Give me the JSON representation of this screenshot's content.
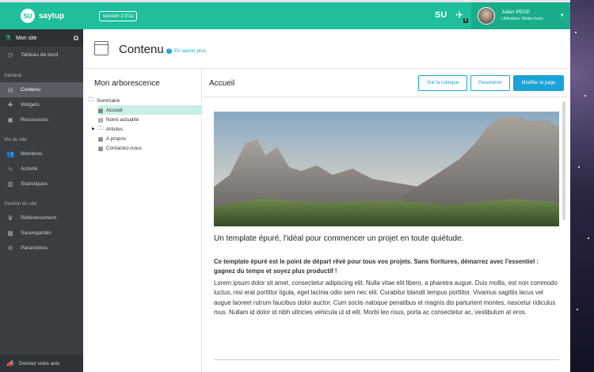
{
  "app": {
    "logo_mark": "SU",
    "logo_text": "saytup",
    "version": "version 2.01a"
  },
  "sidebar": {
    "site": {
      "label": "Mon site",
      "icon": "flask-icon"
    },
    "dashboard": "Tableau de bord",
    "sections": [
      {
        "title": "Général",
        "items": [
          {
            "label": "Contenu",
            "icon": "content-icon",
            "active": true
          },
          {
            "label": "Widgets",
            "icon": "puzzle-icon"
          },
          {
            "label": "Ressources",
            "icon": "image-icon"
          }
        ]
      },
      {
        "title": "Vie du site",
        "items": [
          {
            "label": "Membres",
            "icon": "users-icon"
          },
          {
            "label": "Activité",
            "icon": "activity-icon"
          },
          {
            "label": "Statistiques",
            "icon": "chart-icon"
          }
        ]
      },
      {
        "title": "Gestion du site",
        "items": [
          {
            "label": "Référencement",
            "icon": "trophy-icon"
          },
          {
            "label": "Sauvegardes",
            "icon": "save-icon"
          },
          {
            "label": "Paramètres",
            "icon": "gear-icon"
          }
        ]
      }
    ],
    "feedback": "Donnez votre avis"
  },
  "topbar": {
    "su_icon": "SU",
    "notification_count": "6",
    "user": {
      "name": "Julien PEGE",
      "role": "Utilisateur Webo-facto"
    }
  },
  "header": {
    "title": "Contenu",
    "help_link": "En savoir plus"
  },
  "tree": {
    "title": "Mon arborescence",
    "root": "Sommaire",
    "items": [
      "Accueil",
      "Notre actualité",
      "Articles",
      "A propos",
      "Contactez-nous"
    ]
  },
  "main": {
    "page_name": "Accueil",
    "buttons": {
      "view": "Voir la rubrique",
      "settings": "Paramétrer",
      "edit": "Modifier la page"
    },
    "tagline": "Un template épuré, l'idéal pour commencer un projet en toute quiétude.",
    "lead": "Ce template épuré est le point de départ rêvé pour tous vos projets. Sans fioritures, démarrez avec l'essentiel : gagnez du temps et soyez plus productif !",
    "body": "Lorem ipsum dolor sit amet, consectetur adipiscing elit. Nulla vitae elit libero, a pharetra augue. Duis mollis, est non commodo luctus, nisi erat porttitor ligula, eget lacinia odio sem nec elit. Curabitur blandit tempus porttitor. Vivamus sagittis lacus vel augue laoreet rutrum faucibus dolor auctor. Cum sociis natoque penatibus et magnis dis parturient montes, nascetur ridiculus mus. Nullam id dolor id nibh ultricies vehicula ut id elit. Morbi leo risus, porta ac consectetur ac, vestibulum at eros."
  },
  "colors": {
    "brand": "#1ebf9a",
    "accent": "#1aa3d8",
    "sidebar": "#3a3d42",
    "active_tree": "#c9efe7"
  }
}
